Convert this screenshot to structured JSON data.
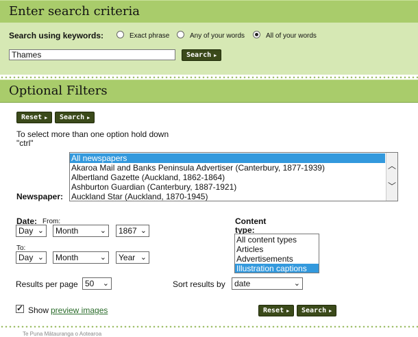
{
  "search": {
    "header_title": "Enter search criteria",
    "keywords_label": "Search using keywords:",
    "mode_options": [
      {
        "label": "Exact phrase",
        "selected": false
      },
      {
        "label": "Any of your words",
        "selected": false
      },
      {
        "label": "All of your words",
        "selected": true
      }
    ],
    "query_value": "Thames",
    "search_button": "Search"
  },
  "filters": {
    "header_title": "Optional Filters",
    "reset_button": "Reset",
    "search_button": "Search",
    "hint_line1": "To select more than one option hold down",
    "hint_line2": "\"ctrl\"",
    "newspaper_label": "Newspaper:",
    "newspaper_options": [
      {
        "label": "All newspapers",
        "selected": true
      },
      {
        "label": "Akaroa Mail and Banks Peninsula Advertiser (Canterbury, 1877-1939)",
        "selected": false
      },
      {
        "label": "Albertland Gazette (Auckland, 1862-1864)",
        "selected": false
      },
      {
        "label": "Ashburton Guardian (Canterbury, 1887-1921)",
        "selected": false
      },
      {
        "label": "Auckland Star (Auckland, 1870-1945)",
        "selected": false
      }
    ],
    "date_label": "Date:",
    "from_label": "From:",
    "to_label": "To:",
    "from_day": "Day",
    "from_month": "Month",
    "from_year": "1867",
    "to_day": "Day",
    "to_month": "Month",
    "to_year": "Year",
    "content_type_label_line1": "Content",
    "content_type_label_line2": "type:",
    "content_types": [
      {
        "label": "All content types",
        "selected": false
      },
      {
        "label": "Articles",
        "selected": false
      },
      {
        "label": "Advertisements",
        "selected": false
      },
      {
        "label": "Illustration captions",
        "selected": true
      }
    ],
    "results_per_page_label": "Results per page",
    "results_per_page_value": "50",
    "sort_label": "Sort results by",
    "sort_value": "date",
    "show_label": "Show",
    "preview_link": "preview images",
    "preview_checked": true,
    "footer_text": "Te Puna Mātauranga o Aotearoa"
  },
  "colors": {
    "header_green": "#a9cc6b",
    "panel_green": "#d6e8b4",
    "button_dark": "#3b4a1a",
    "selection_blue": "#3399dd",
    "link_green": "#2a6b2a"
  },
  "icons": [
    "radio-icon",
    "arrow-right-icon",
    "chevron-down-icon",
    "chevron-up-icon",
    "checkbox-icon"
  ]
}
